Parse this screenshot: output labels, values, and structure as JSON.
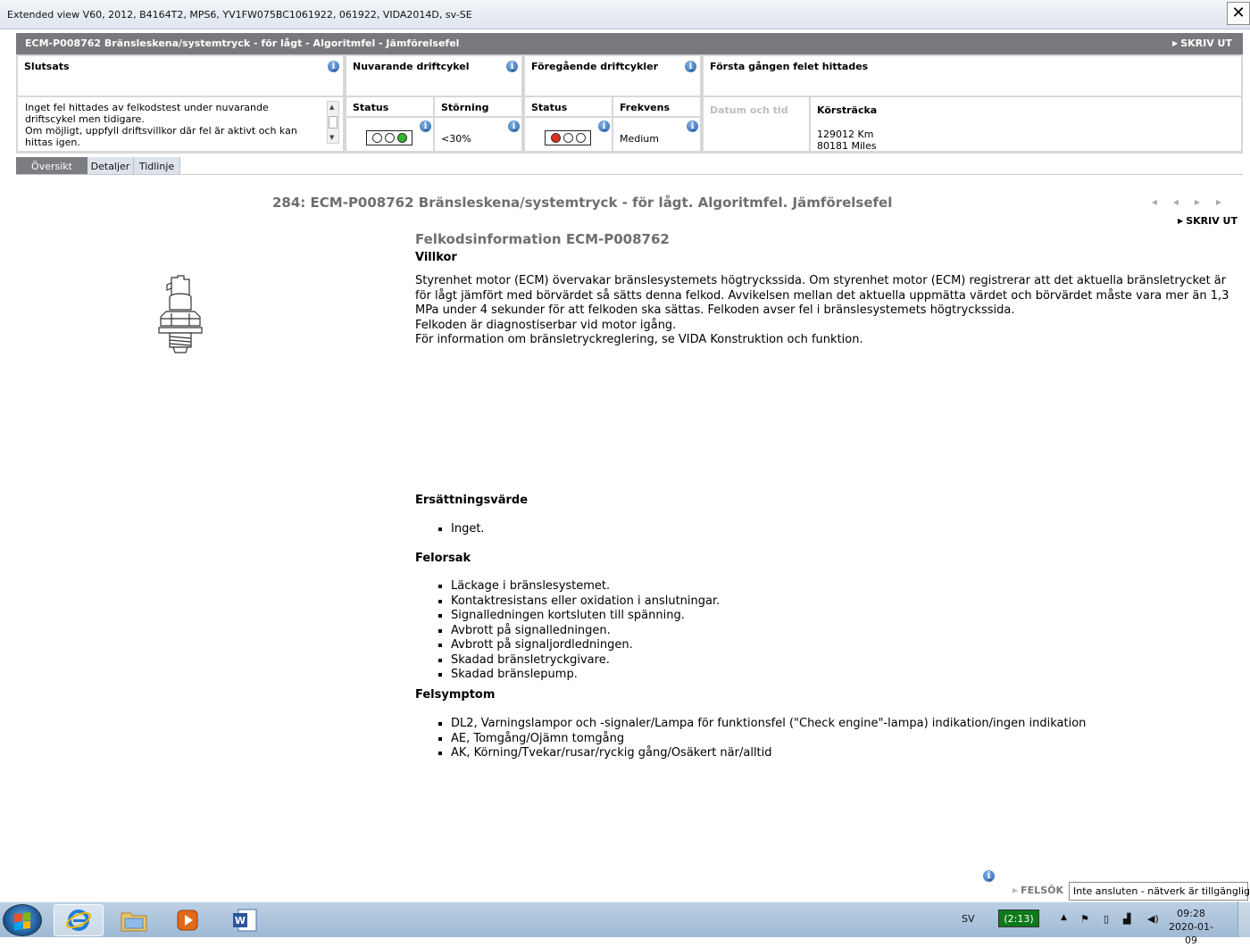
{
  "window": {
    "title": "Extended view    V60, 2012, B4164T2, MPS6, YV1FW075BC1061922, 061922, VIDA2014D, sv-SE",
    "close": "✕"
  },
  "header": {
    "title": "ECM-P008762 Bränsleskena/systemtryck - för lågt - Algoritmfel - Jämförelsefel",
    "print": "SKRIV UT"
  },
  "info": {
    "slutsats": {
      "label": "Slutsats",
      "text": "Inget fel hittades av felkodstest under nuvarande driftscykel men tidigare.\nOm möjligt, uppfyll driftsvillkor där fel är aktivt och kan hittas igen."
    },
    "current_cycle": {
      "label": "Nuvarande driftcykel",
      "status_label": "Status",
      "disturbance_label": "Störning",
      "disturbance_value": "<30%",
      "lamps": [
        "off",
        "off",
        "green"
      ]
    },
    "previous_cycles": {
      "label": "Föregående driftcykler",
      "status_label": "Status",
      "frequency_label": "Frekvens",
      "frequency_value": "Medium",
      "lamps": [
        "red",
        "off",
        "off"
      ]
    },
    "first_found": {
      "label": "Första gången felet hittades",
      "datetime_label": "Datum och tid",
      "mileage_label": "Körsträcka",
      "mileage_km": "129012 Km",
      "mileage_miles": "80181 Miles"
    }
  },
  "tabs": [
    "Översikt",
    "Detaljer",
    "Tidlinje"
  ],
  "doc": {
    "title": "284: ECM-P008762 Bränsleskena/systemtryck - för lågt. Algoritmfel. Jämförelsefel",
    "nav_prev": "◂◂",
    "nav_next": "▸▸",
    "print": "SKRIV UT",
    "heading": "Felkodsinformation ECM-P008762",
    "villkor_title": "Villkor",
    "villkor_text": "Styrenhet motor (ECM) övervakar bränslesystemets högtryckssida. Om styrenhet motor (ECM) registrerar att det aktuella bränsletrycket är för lågt jämfört med börvärdet så sätts denna felkod. Avvikelsen mellan det aktuella uppmätta värdet och börvärdet måste vara mer än 1,3 MPa under 4 sekunder för att felkoden ska sättas. Felkoden avser fel i bränslesystemets högtryckssida.",
    "villkor_line2": "Felkoden är diagnostiserbar vid motor igång.",
    "villkor_line3": "För information om bränsletryckreglering, se VIDA Konstruktion och funktion.",
    "ersattning_title": "Ersättningsvärde",
    "ersattning_items": [
      "Inget."
    ],
    "felorsak_title": "Felorsak",
    "felorsak_items": [
      "Läckage i bränslesystemet.",
      "Kontaktresistans eller oxidation i anslutningar.",
      "Signalledningen kortsluten till spänning.",
      "Avbrott på signalledningen.",
      "Avbrott på signaljordledningen.",
      "Skadad bränsletryckgivare.",
      "Skadad bränslepump."
    ],
    "felsymptom_title": "Felsymptom",
    "felsymptom_items": [
      "DL2, Varningslampor och -signaler/Lampa för funktionsfel (\"Check engine\"-lampa) indikation/ingen indikation",
      "AE, Tomgång/Ojämn tomgång",
      "AK, Körning/Tvekar/rusar/ryckig gång/Osäkert när/alltid"
    ]
  },
  "footer": {
    "felsok": "FELSÖK",
    "tooltip": "Inte ansluten - nätverk är tillgängliga"
  },
  "taskbar": {
    "language": "SV",
    "battery": "(2:13)",
    "time": "09:28",
    "date": "2020-01-09"
  },
  "colors": {
    "header_bg": "#77797c",
    "lamp_red": "#e0301e",
    "lamp_green": "#2fb52f",
    "battery_bg": "#0c7a1a"
  }
}
